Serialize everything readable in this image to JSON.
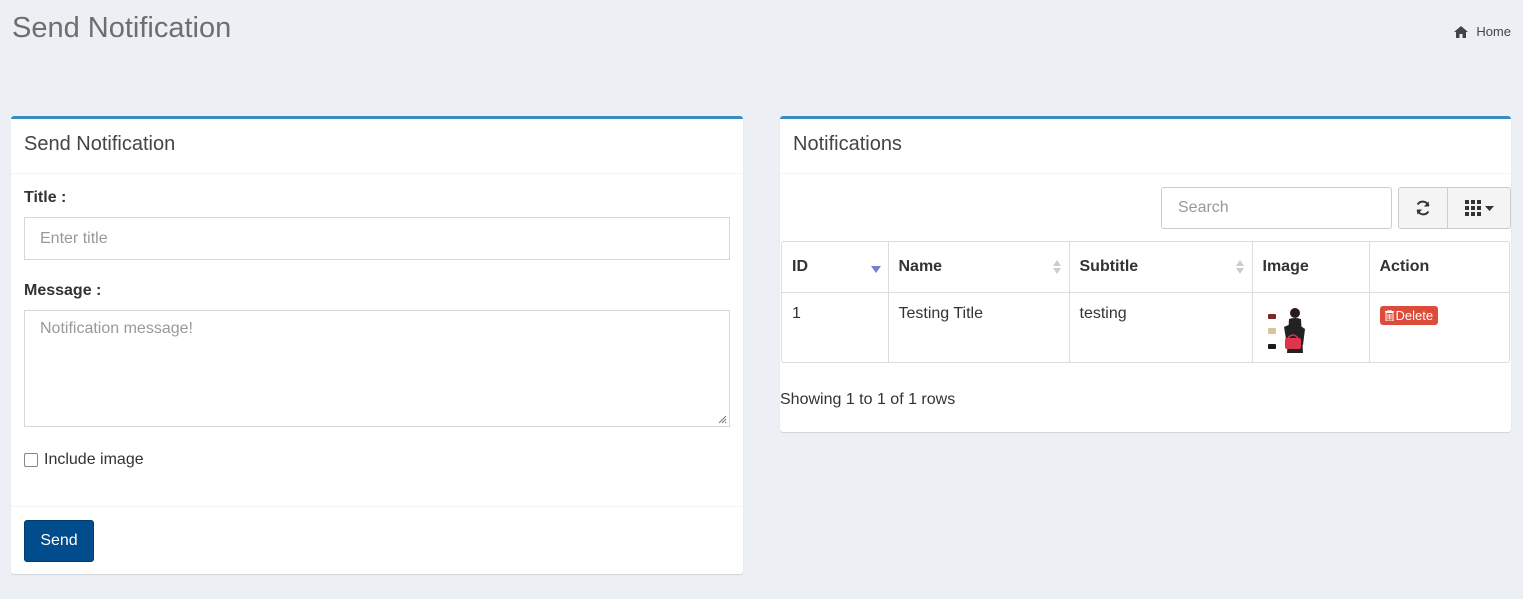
{
  "page": {
    "title": "Send Notification",
    "breadcrumb": {
      "icon": "home-icon",
      "label": "Home"
    }
  },
  "form": {
    "box_title": "Send Notification",
    "title_label": "Title :",
    "title_placeholder": "Enter title",
    "message_label": "Message :",
    "message_placeholder": "Notification message!",
    "include_image_label": "Include image",
    "include_image_checked": false,
    "send_label": "Send"
  },
  "notifications": {
    "box_title": "Notifications",
    "search_placeholder": "Search",
    "columns": [
      "ID",
      "Name",
      "Subtitle",
      "Image",
      "Action"
    ],
    "rows": [
      {
        "id": "1",
        "name": "Testing Title",
        "subtitle": "testing",
        "image": "thumbnail",
        "action": "Delete"
      }
    ],
    "showing": "Showing 1 to 1 of 1 rows"
  },
  "colors": {
    "accent": "#3c8dbc",
    "send_button": "#004c8c",
    "delete_button": "#dd4b39",
    "background": "#ecf0f5"
  }
}
